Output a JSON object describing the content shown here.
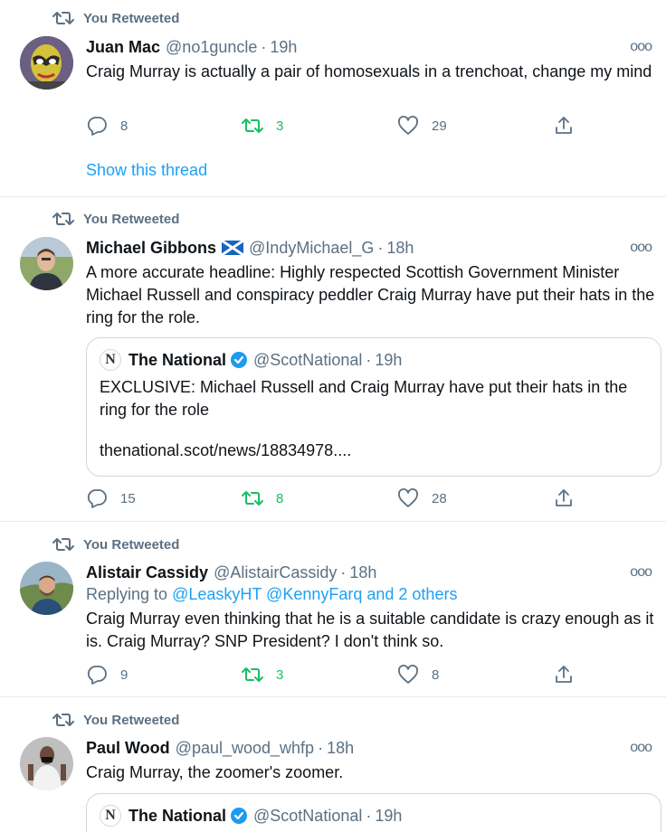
{
  "colors": {
    "accent": "#1da1f2",
    "retweet_active": "#17bf63",
    "muted": "#5b7083",
    "verified": "#1d9bf0"
  },
  "tweets": [
    {
      "retweet_label": "You Retweeted",
      "name": "Juan Mac",
      "handle": "@no1guncle",
      "time": "19h",
      "text": "Craig Murray is actually a pair of homosexuals in a trenchoat, change my mind",
      "replies": "8",
      "retweets": "3",
      "likes": "29",
      "show_thread": "Show this thread"
    },
    {
      "retweet_label": "You Retweeted",
      "name": "Michael Gibbons",
      "flag_icon": "scotland-flag-icon",
      "handle": "@IndyMichael_G",
      "time": "18h",
      "text": "A more accurate headline: Highly respected Scottish Government Minister Michael Russell and conspiracy peddler Craig Murray have put their hats in the ring for the role.",
      "quote": {
        "logo_letter": "N",
        "name": "The National",
        "handle": "@ScotNational",
        "time": "19h",
        "text": "EXCLUSIVE: Michael Russell and Craig Murray have put their hats in the ring for the role",
        "link": "thenational.scot/news/18834978...."
      },
      "replies": "15",
      "retweets": "8",
      "likes": "28"
    },
    {
      "retweet_label": "You Retweeted",
      "name": "Alistair Cassidy",
      "handle": "@AlistairCassidy",
      "time": "18h",
      "replying_prefix": "Replying to",
      "replying_to": "@LeaskyHT @KennyFarq and 2 others",
      "text": "Craig Murray even thinking that he is a suitable candidate is crazy enough as it is. Craig Murray? SNP President? I don't think so.",
      "replies": "9",
      "retweets": "3",
      "likes": "8"
    },
    {
      "retweet_label": "You Retweeted",
      "name": "Paul Wood",
      "handle": "@paul_wood_whfp",
      "time": "18h",
      "text": "Craig Murray, the zoomer's zoomer.",
      "quote": {
        "logo_letter": "N",
        "name": "The National",
        "handle": "@ScotNational",
        "time": "19h"
      }
    }
  ]
}
